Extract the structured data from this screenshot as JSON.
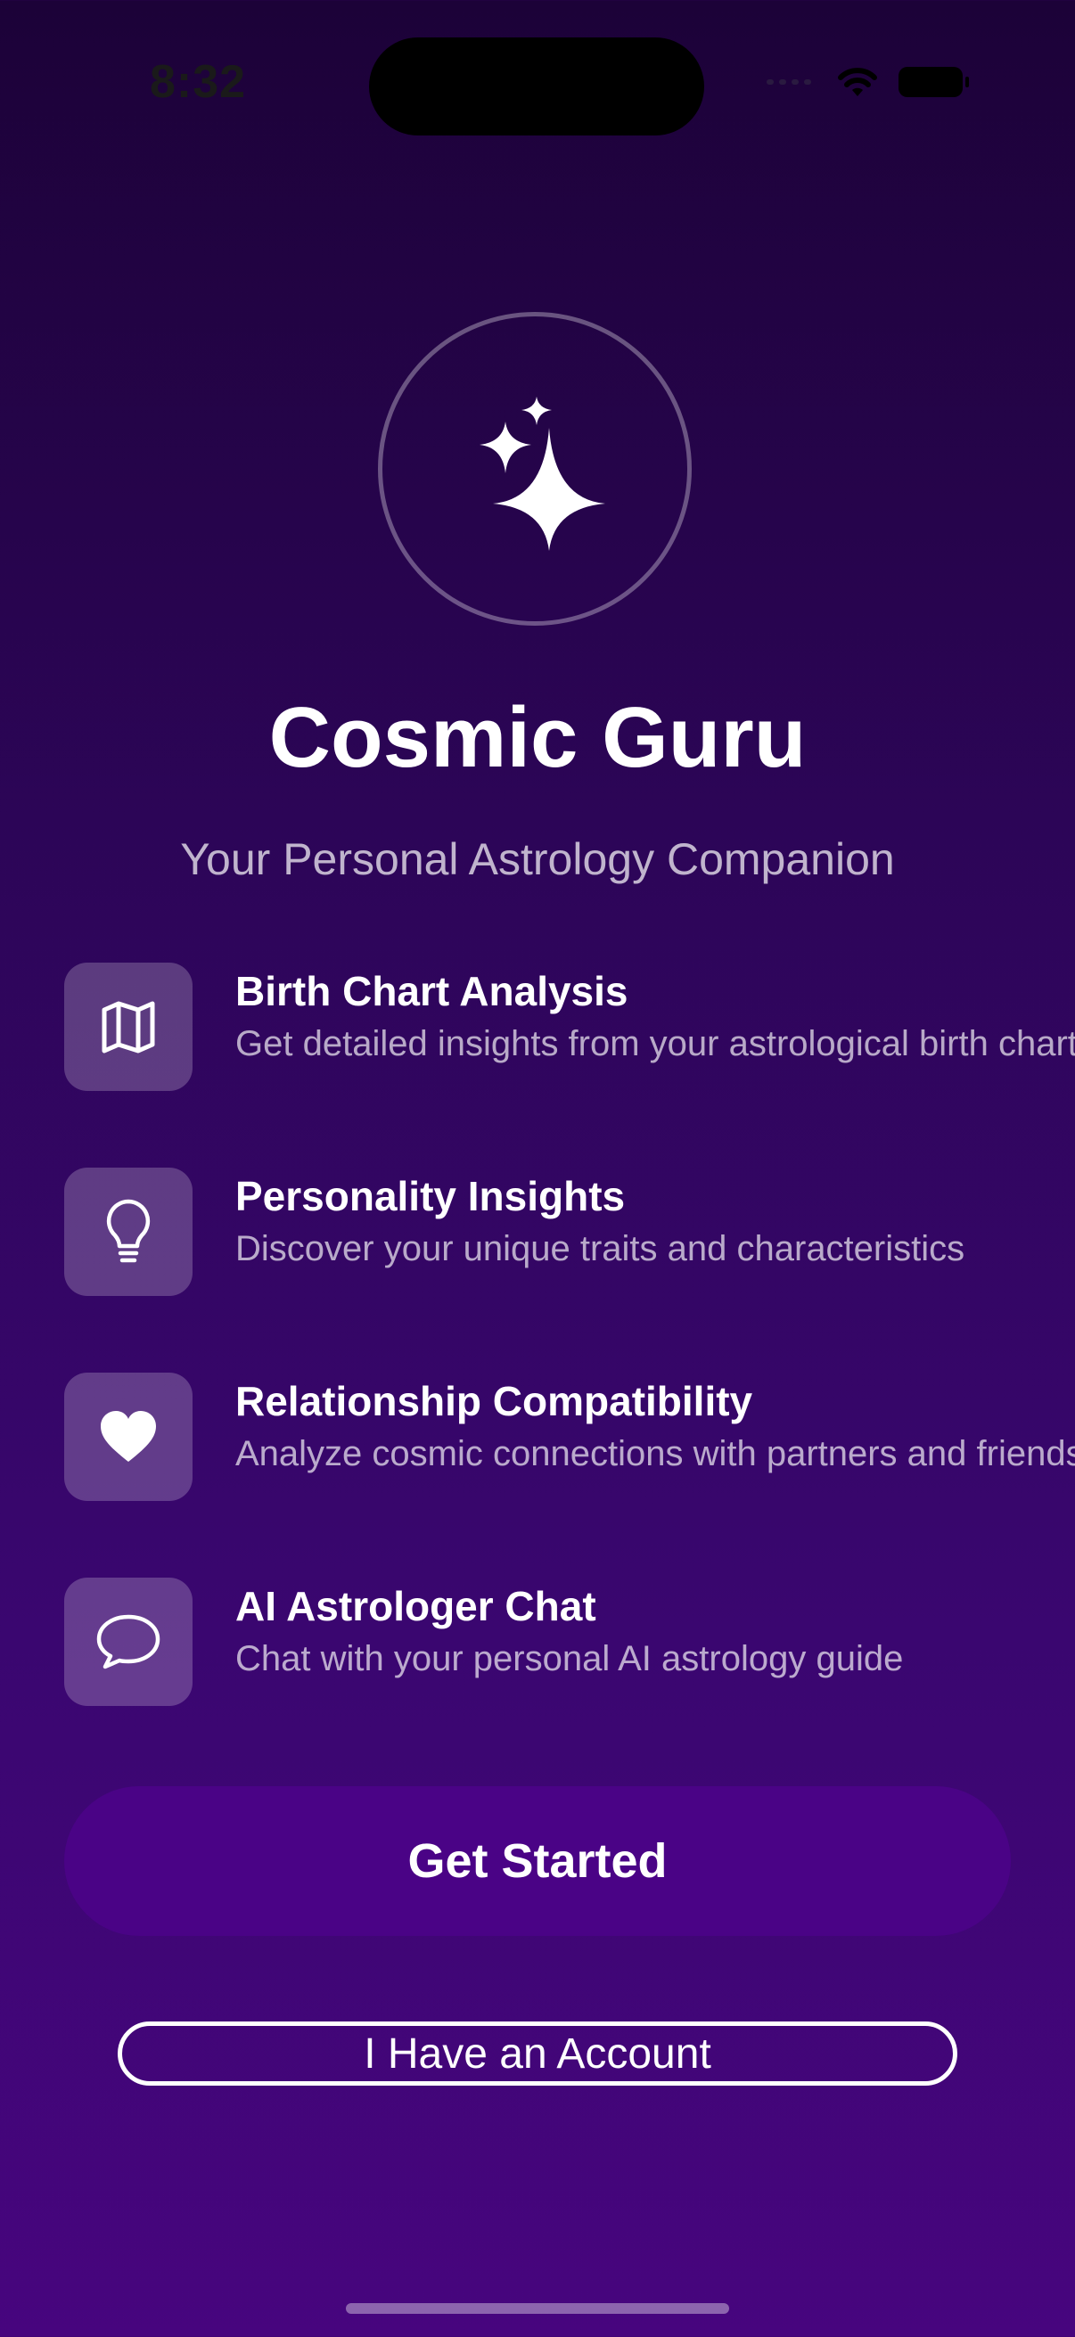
{
  "status_bar": {
    "time": "8:32",
    "icons": [
      "signal-dots-icon",
      "wifi-icon",
      "battery-icon"
    ]
  },
  "logo": {
    "icon": "sparkles-icon"
  },
  "app": {
    "title": "Cosmic Guru",
    "subtitle": "Your Personal Astrology Companion"
  },
  "features": [
    {
      "icon": "map-icon",
      "title": "Birth Chart Analysis",
      "description": "Get detailed insights from your astrological birth chart"
    },
    {
      "icon": "lightbulb-icon",
      "title": "Personality Insights",
      "description": "Discover your unique traits and characteristics"
    },
    {
      "icon": "heart-icon",
      "title": "Relationship Compatibility",
      "description": "Analyze cosmic connections with partners and friends"
    },
    {
      "icon": "chat-bubble-icon",
      "title": "AI Astrologer Chat",
      "description": "Chat with your personal AI astrology guide"
    }
  ],
  "buttons": {
    "get_started": "Get Started",
    "have_account": "I Have an Account"
  },
  "colors": {
    "background_top": "#1c0238",
    "background_bottom": "#47057e",
    "primary_button": "#4a0386"
  }
}
